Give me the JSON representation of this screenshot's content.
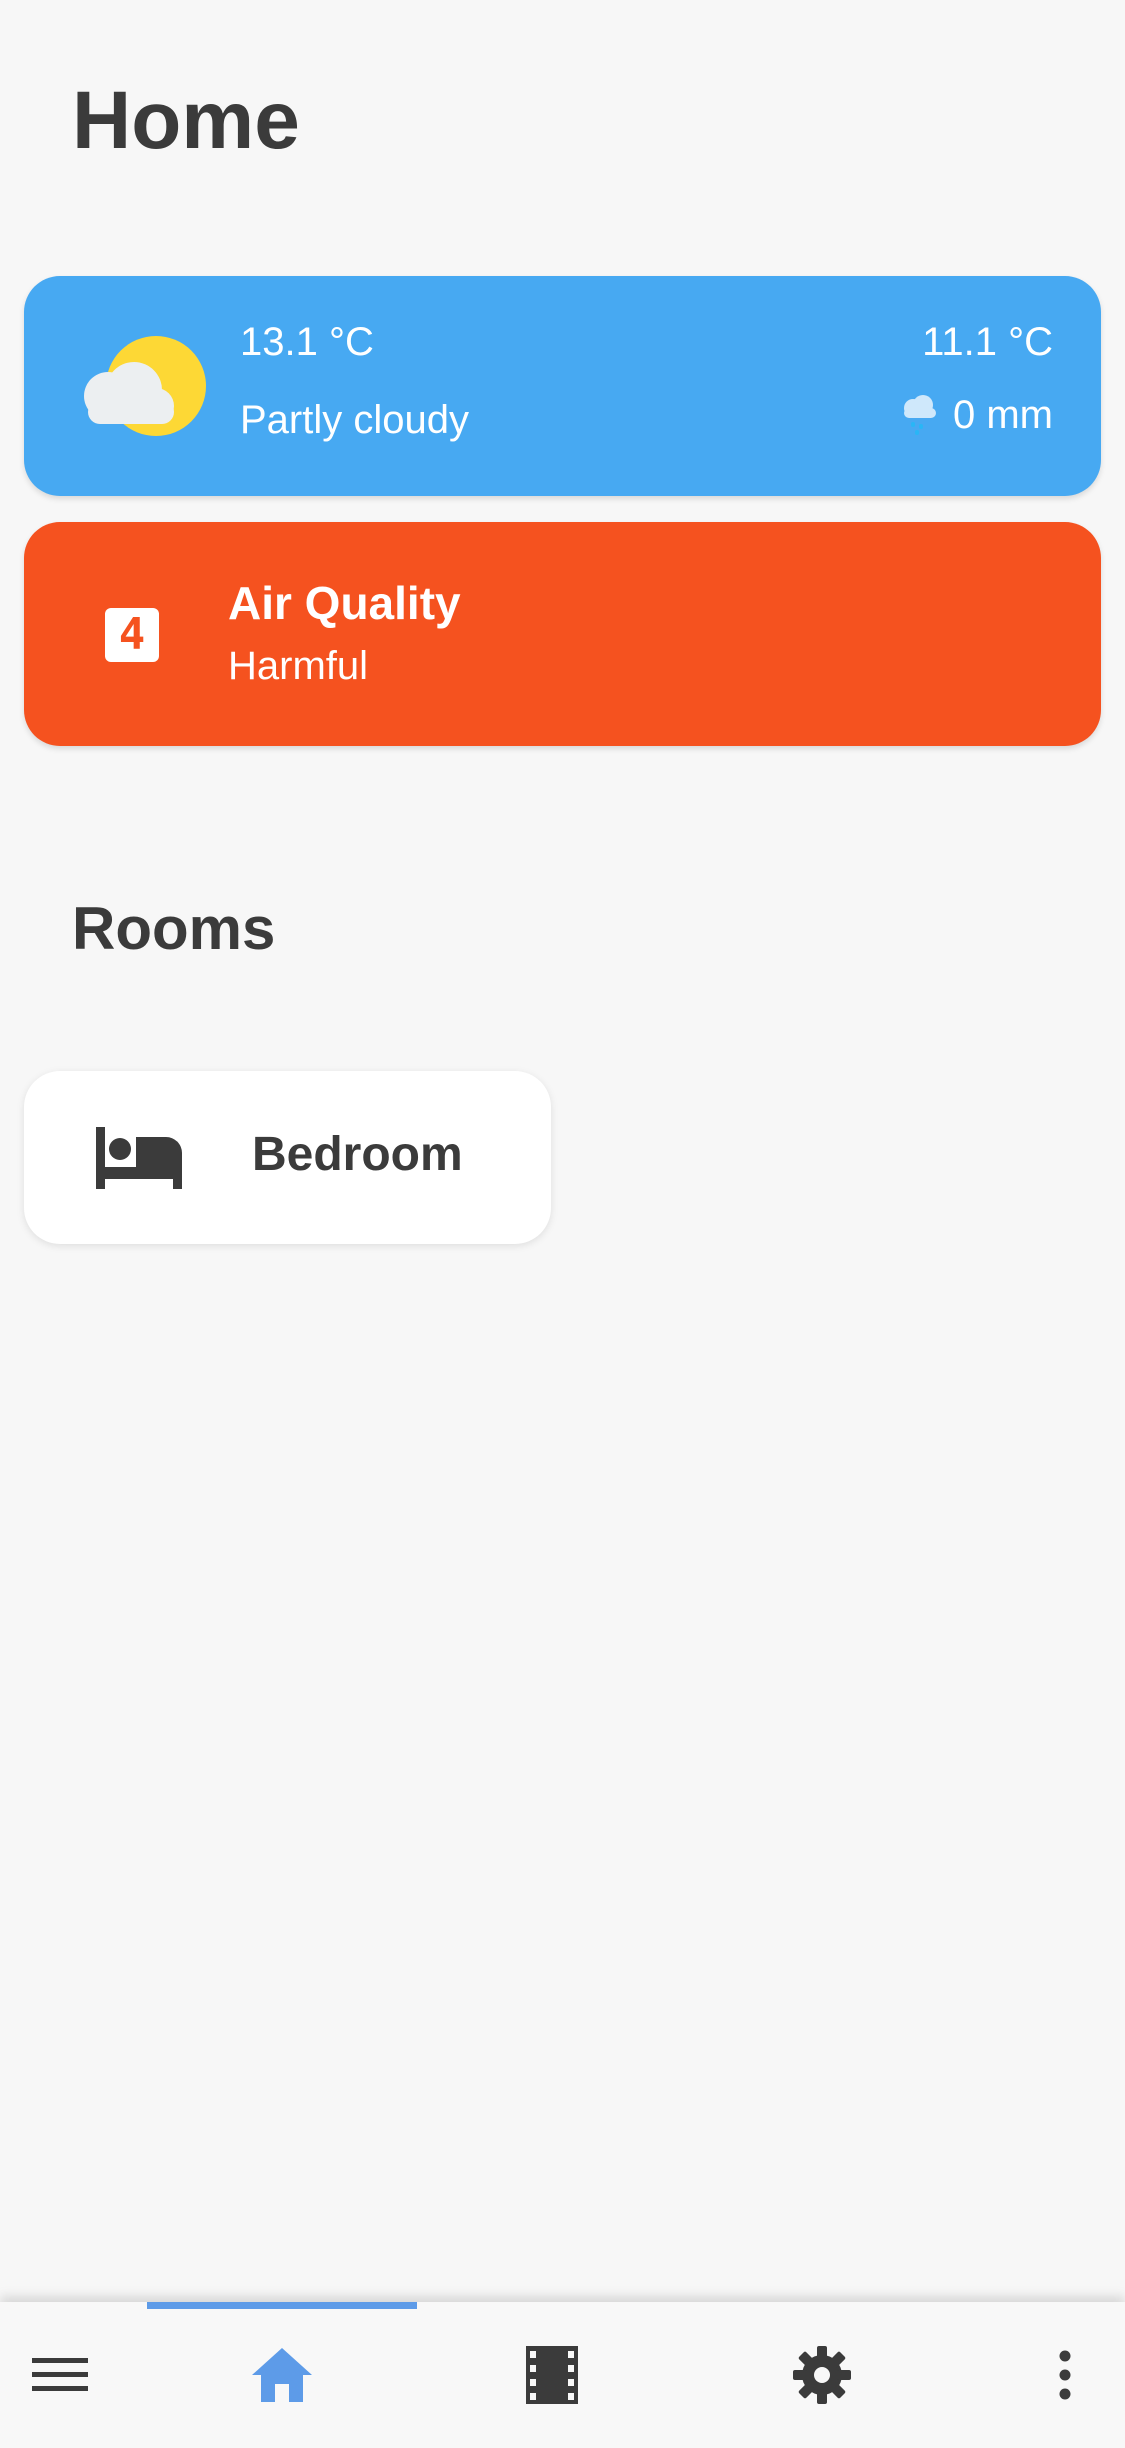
{
  "header": {
    "title": "Home"
  },
  "weather": {
    "temperature": "13.1 °C",
    "condition": "Partly cloudy",
    "temperature_secondary": "11.1 °C",
    "precipitation": "0 mm",
    "icon": "partly-cloudy-icon",
    "color": "#47a9f2"
  },
  "air_quality": {
    "index": "4",
    "title": "Air Quality",
    "status": "Harmful",
    "color": "#f5521f"
  },
  "rooms": {
    "title": "Rooms",
    "items": [
      {
        "label": "Bedroom",
        "icon": "bed-icon"
      }
    ]
  },
  "bottom_nav": {
    "items": [
      {
        "icon": "menu-icon",
        "active": false
      },
      {
        "icon": "home-icon",
        "active": true
      },
      {
        "icon": "film-icon",
        "active": false
      },
      {
        "icon": "gear-icon",
        "active": false
      },
      {
        "icon": "more-vertical-icon",
        "active": false
      }
    ],
    "active_color": "#5d9be8"
  }
}
